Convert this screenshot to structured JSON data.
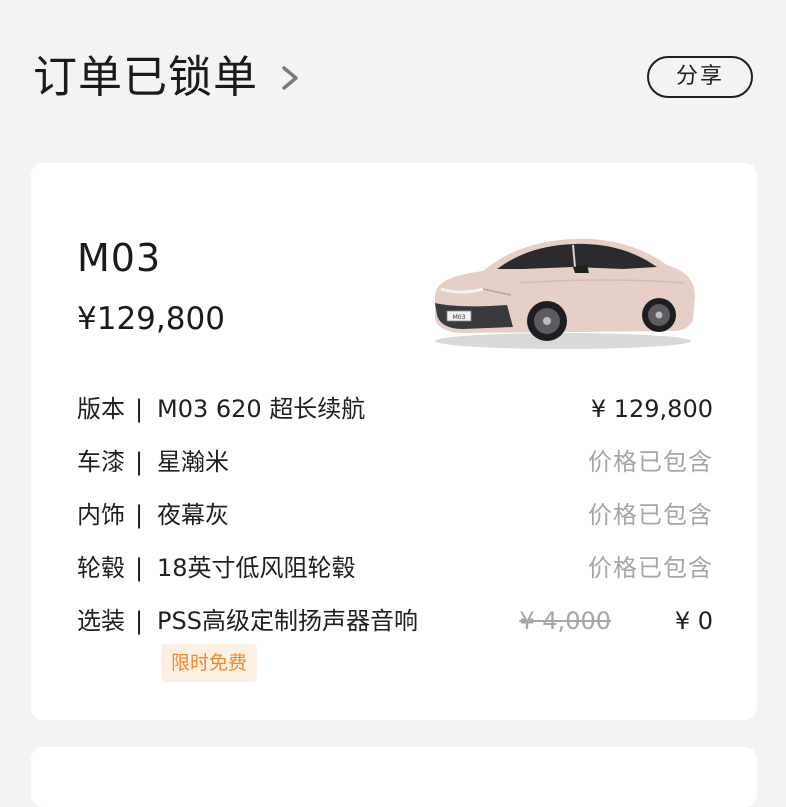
{
  "header": {
    "title": "订单已锁单",
    "share_label": "分享"
  },
  "order": {
    "model": "M03",
    "price": "¥129,800",
    "specs": [
      {
        "label": "版本",
        "value": "M03 620 超长续航",
        "price": "¥ 129,800"
      },
      {
        "label": "车漆",
        "value": "星瀚米",
        "price": "价格已包含"
      },
      {
        "label": "内饰",
        "value": "夜幕灰",
        "price": "价格已包含"
      },
      {
        "label": "轮毂",
        "value": "18英寸低风阻轮毂",
        "price": "价格已包含"
      },
      {
        "label": "选装",
        "value": "PSS高级定制扬声器音响",
        "original_price": "¥ 4,000",
        "price": "¥ 0"
      }
    ],
    "separator": "|",
    "promo_badge": "限时免费"
  },
  "icons": {
    "title_chevron": "chevron-right-icon",
    "car": "car-image"
  },
  "colors": {
    "background": "#f3f3f3",
    "card": "#ffffff",
    "muted_text": "#a6a6a6",
    "promo_text": "#f08a28",
    "promo_bg": "#fdf0e3",
    "car_body": "#e6cfc6"
  }
}
